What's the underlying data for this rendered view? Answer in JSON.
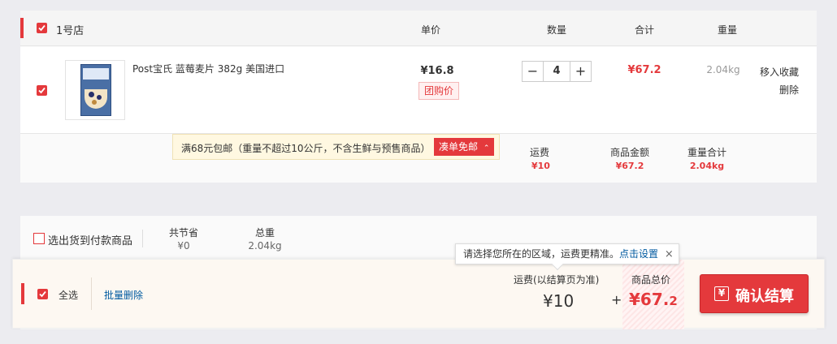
{
  "shop": {
    "name": "1号店",
    "columns": {
      "unit_price": "单价",
      "quantity": "数量",
      "subtotal": "合计",
      "weight": "重量"
    }
  },
  "item": {
    "title": "Post宝氏 蓝莓麦片 382g 美国进口",
    "unit_price": "¥16.8",
    "group_buy_tag": "团购价",
    "quantity": "4",
    "subtotal": "¥67.2",
    "weight": "2.04kg",
    "actions": {
      "move_to_favorites": "移入收藏",
      "delete": "删除"
    }
  },
  "shop_summary": {
    "promo_text": "满68元包邮（重量不超过10公斤，不含生鲜与预售商品）",
    "promo_button": "凑单免邮",
    "shipping_label": "运费",
    "shipping_value": "¥10",
    "amount_label": "商品金额",
    "amount_value": "¥67.2",
    "weight_label": "重量合计",
    "weight_value": "2.04kg"
  },
  "footer_info": {
    "cod_label": "选出货到付款商品",
    "saved_label": "共节省",
    "saved_value": "¥0",
    "total_weight_label": "总重",
    "total_weight_value": "2.04kg"
  },
  "tooltip": {
    "text": "请选择您所在的区域，运费更精准。",
    "link": "点击设置",
    "close": "×"
  },
  "cart_bar": {
    "select_all": "全选",
    "batch_delete": "批量删除",
    "shipping_label": "运费(以结算页为准)",
    "shipping_value": "¥10",
    "plus": "+",
    "total_label": "商品总价",
    "total_value": "¥67.",
    "total_value_decimal": "2",
    "checkout_icon": "¥",
    "checkout_label": "确认结算"
  },
  "stepper": {
    "minus": "−",
    "plus": "+"
  },
  "colors": {
    "accent": "#e4393c",
    "link": "#005aa0"
  }
}
